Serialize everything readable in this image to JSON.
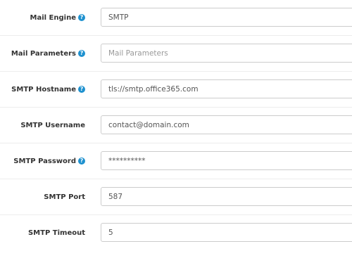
{
  "form": {
    "rows": [
      {
        "label": "Mail Engine",
        "help": true,
        "value": "SMTP",
        "type": "select"
      },
      {
        "label": "Mail Parameters",
        "help": true,
        "value": "",
        "placeholder": "Mail Parameters",
        "type": "text"
      },
      {
        "label": "SMTP Hostname",
        "help": true,
        "value": "tls://smtp.office365.com",
        "type": "text"
      },
      {
        "label": "SMTP Username",
        "help": false,
        "value": "contact@domain.com",
        "type": "text"
      },
      {
        "label": "SMTP Password",
        "help": true,
        "value": "**********",
        "type": "text"
      },
      {
        "label": "SMTP Port",
        "help": false,
        "value": "587",
        "type": "text"
      },
      {
        "label": "SMTP Timeout",
        "help": false,
        "value": "5",
        "type": "text"
      }
    ],
    "help_glyph": "?"
  },
  "colors": {
    "help_icon": "#1e91cf",
    "label_text": "#333333",
    "field_border": "#cccccc"
  }
}
